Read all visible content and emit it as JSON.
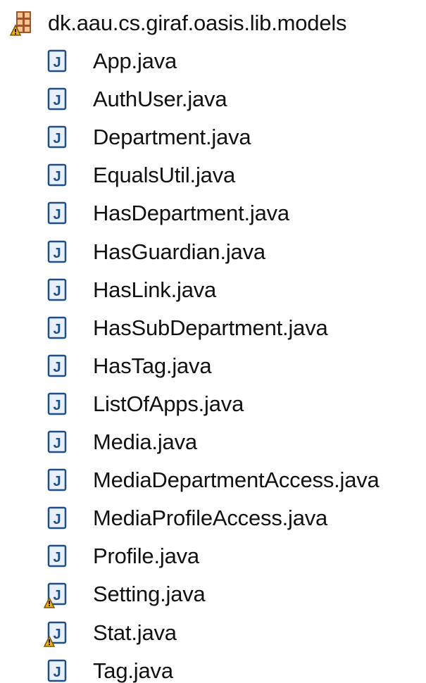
{
  "package": {
    "label": "dk.aau.cs.giraf.oasis.lib.models",
    "icon": "package-icon"
  },
  "files": [
    {
      "label": "App.java",
      "icon": "java-file-icon",
      "warning": false
    },
    {
      "label": "AuthUser.java",
      "icon": "java-file-icon",
      "warning": false
    },
    {
      "label": "Department.java",
      "icon": "java-file-icon",
      "warning": false
    },
    {
      "label": "EqualsUtil.java",
      "icon": "java-file-icon",
      "warning": false
    },
    {
      "label": "HasDepartment.java",
      "icon": "java-file-icon",
      "warning": false
    },
    {
      "label": "HasGuardian.java",
      "icon": "java-file-icon",
      "warning": false
    },
    {
      "label": "HasLink.java",
      "icon": "java-file-icon",
      "warning": false
    },
    {
      "label": "HasSubDepartment.java",
      "icon": "java-file-icon",
      "warning": false
    },
    {
      "label": "HasTag.java",
      "icon": "java-file-icon",
      "warning": false
    },
    {
      "label": "ListOfApps.java",
      "icon": "java-file-icon",
      "warning": false
    },
    {
      "label": "Media.java",
      "icon": "java-file-icon",
      "warning": false
    },
    {
      "label": "MediaDepartmentAccess.java",
      "icon": "java-file-icon",
      "warning": false
    },
    {
      "label": "MediaProfileAccess.java",
      "icon": "java-file-icon",
      "warning": false
    },
    {
      "label": "Profile.java",
      "icon": "java-file-icon",
      "warning": false
    },
    {
      "label": "Setting.java",
      "icon": "java-file-warning-icon",
      "warning": true
    },
    {
      "label": "Stat.java",
      "icon": "java-file-warning-icon",
      "warning": true
    },
    {
      "label": "Tag.java",
      "icon": "java-file-icon",
      "warning": false
    }
  ],
  "colors": {
    "text": "#111111",
    "java_icon_border": "#1d4f86",
    "java_icon_fill": "#e8f0fb",
    "java_letter": "#1d4f86",
    "package_brown": "#a0522d",
    "package_tan": "#f4c68c",
    "warning": "#f0b000"
  }
}
